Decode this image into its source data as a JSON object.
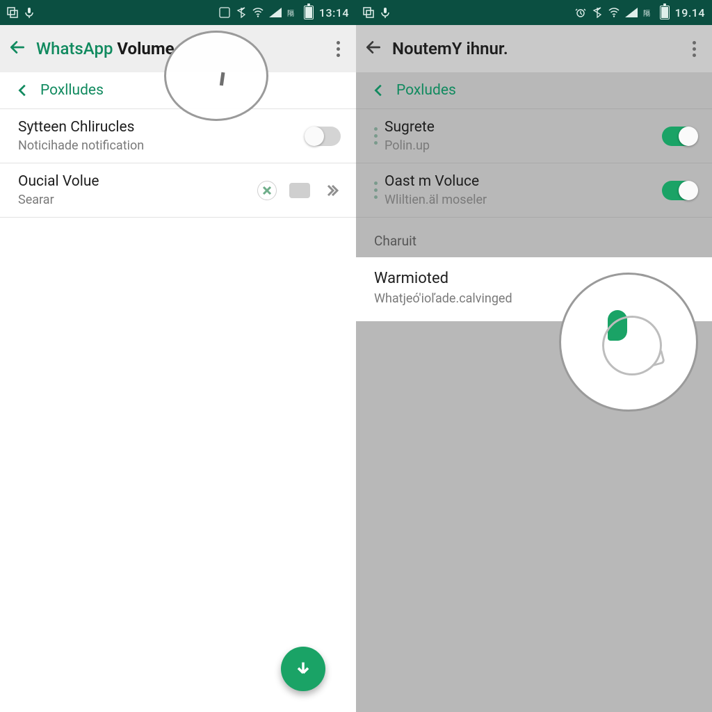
{
  "colors": {
    "accent": "#1aa366",
    "brand": "#118a5f",
    "statusbar": "#0b4f41"
  },
  "left": {
    "statusbar": {
      "clock": "13:14"
    },
    "appbar": {
      "title_brand": "WhatsApp",
      "title_bold": "Volume"
    },
    "seclink": {
      "label": "Poxlludes"
    },
    "rows": [
      {
        "title": "Sytteen Chlirucles",
        "sub": "Noticihade notification",
        "toggle": "off"
      },
      {
        "title": "Oucial Volue",
        "sub": "Searar"
      }
    ]
  },
  "right": {
    "statusbar": {
      "clock": "19.14"
    },
    "appbar": {
      "title": "NoutemY ihnur."
    },
    "seclink": {
      "label": "Poxludes"
    },
    "rows": [
      {
        "title": "Sugrete",
        "sub": "Polin.up",
        "toggle": "on"
      },
      {
        "title": "Oast m Voluce",
        "sub": "Wliltien.äl moseler",
        "toggle": "on"
      }
    ],
    "section": "Charuit",
    "card": {
      "title": "Warmioted",
      "sub": "Whatjeó'ioľade.calvinged"
    }
  }
}
